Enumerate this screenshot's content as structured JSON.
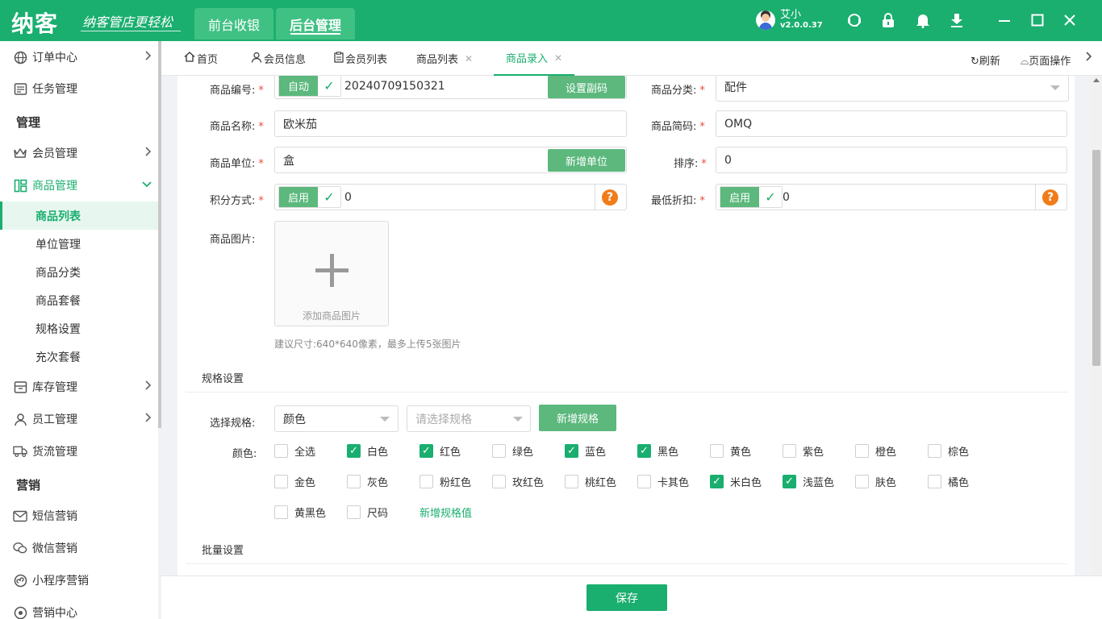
{
  "app": {
    "logo": "纳客",
    "slogan": "纳客管店更轻松",
    "mode_front": "前台收银",
    "mode_back": "后台管理",
    "user_name": "艾小",
    "version": "v2.0.0.37"
  },
  "colors": {
    "brand": "#1aae6f",
    "button_green": "#5cb87d",
    "help_orange": "#f07c1a",
    "required": "#e74c3c"
  },
  "sidebar": {
    "order": "订单中心",
    "task": "任务管理",
    "section_manage": "管理",
    "member": "会员管理",
    "goods": "商品管理",
    "goods_sub": [
      "商品列表",
      "单位管理",
      "商品分类",
      "商品套餐",
      "规格设置",
      "充次套餐"
    ],
    "stock": "库存管理",
    "staff": "员工管理",
    "logistics": "货流管理",
    "section_marketing": "营销",
    "sms": "短信营销",
    "wechat": "微信营销",
    "miniapp": "小程序营销",
    "marketing_center": "营销中心"
  },
  "tabs": {
    "home": "首页",
    "member_info": "会员信息",
    "member_list": "会员列表",
    "goods_list": "商品列表",
    "goods_entry": "商品录入",
    "refresh": "刷新",
    "page_ops": "页面操作"
  },
  "form": {
    "code_label": "商品编号:",
    "code_auto": "自动",
    "code_value": "20240709150321",
    "code_btn": "设置副码",
    "category_label": "商品分类:",
    "category_value": "配件",
    "name_label": "商品名称:",
    "name_value": "欧米茄",
    "short_label": "商品简码:",
    "short_value": "OMQ",
    "unit_label": "商品单位:",
    "unit_value": "盒",
    "unit_btn": "新增单位",
    "sort_label": "排序:",
    "sort_value": "0",
    "points_label": "积分方式:",
    "points_toggle": "启用",
    "points_value": "0",
    "discount_label": "最低折扣:",
    "discount_toggle": "启用",
    "discount_value": "0",
    "image_label": "商品图片:",
    "image_add": "添加商品图片",
    "image_hint": "建议尺寸:640*640像素，最多上传5张图片"
  },
  "spec": {
    "title": "规格设置",
    "select_label": "选择规格:",
    "select_value": "颜色",
    "select_placeholder": "请选择规格",
    "add_btn": "新增规格",
    "color_label": "颜色:",
    "options": [
      {
        "label": "全选",
        "checked": false
      },
      {
        "label": "白色",
        "checked": true
      },
      {
        "label": "红色",
        "checked": true
      },
      {
        "label": "绿色",
        "checked": false
      },
      {
        "label": "蓝色",
        "checked": true
      },
      {
        "label": "黑色",
        "checked": true
      },
      {
        "label": "黄色",
        "checked": false
      },
      {
        "label": "紫色",
        "checked": false
      },
      {
        "label": "橙色",
        "checked": false
      },
      {
        "label": "棕色",
        "checked": false
      },
      {
        "label": "金色",
        "checked": false
      },
      {
        "label": "灰色",
        "checked": false
      },
      {
        "label": "粉红色",
        "checked": false
      },
      {
        "label": "玫红色",
        "checked": false
      },
      {
        "label": "桃红色",
        "checked": false
      },
      {
        "label": "卡其色",
        "checked": false
      },
      {
        "label": "米白色",
        "checked": true
      },
      {
        "label": "浅蓝色",
        "checked": true
      },
      {
        "label": "肤色",
        "checked": false
      },
      {
        "label": "橘色",
        "checked": false
      },
      {
        "label": "黄黑色",
        "checked": false
      },
      {
        "label": "尺码",
        "checked": false
      }
    ],
    "add_value": "新增规格值"
  },
  "batch": {
    "title": "批量设置"
  },
  "footer": {
    "save": "保存"
  }
}
